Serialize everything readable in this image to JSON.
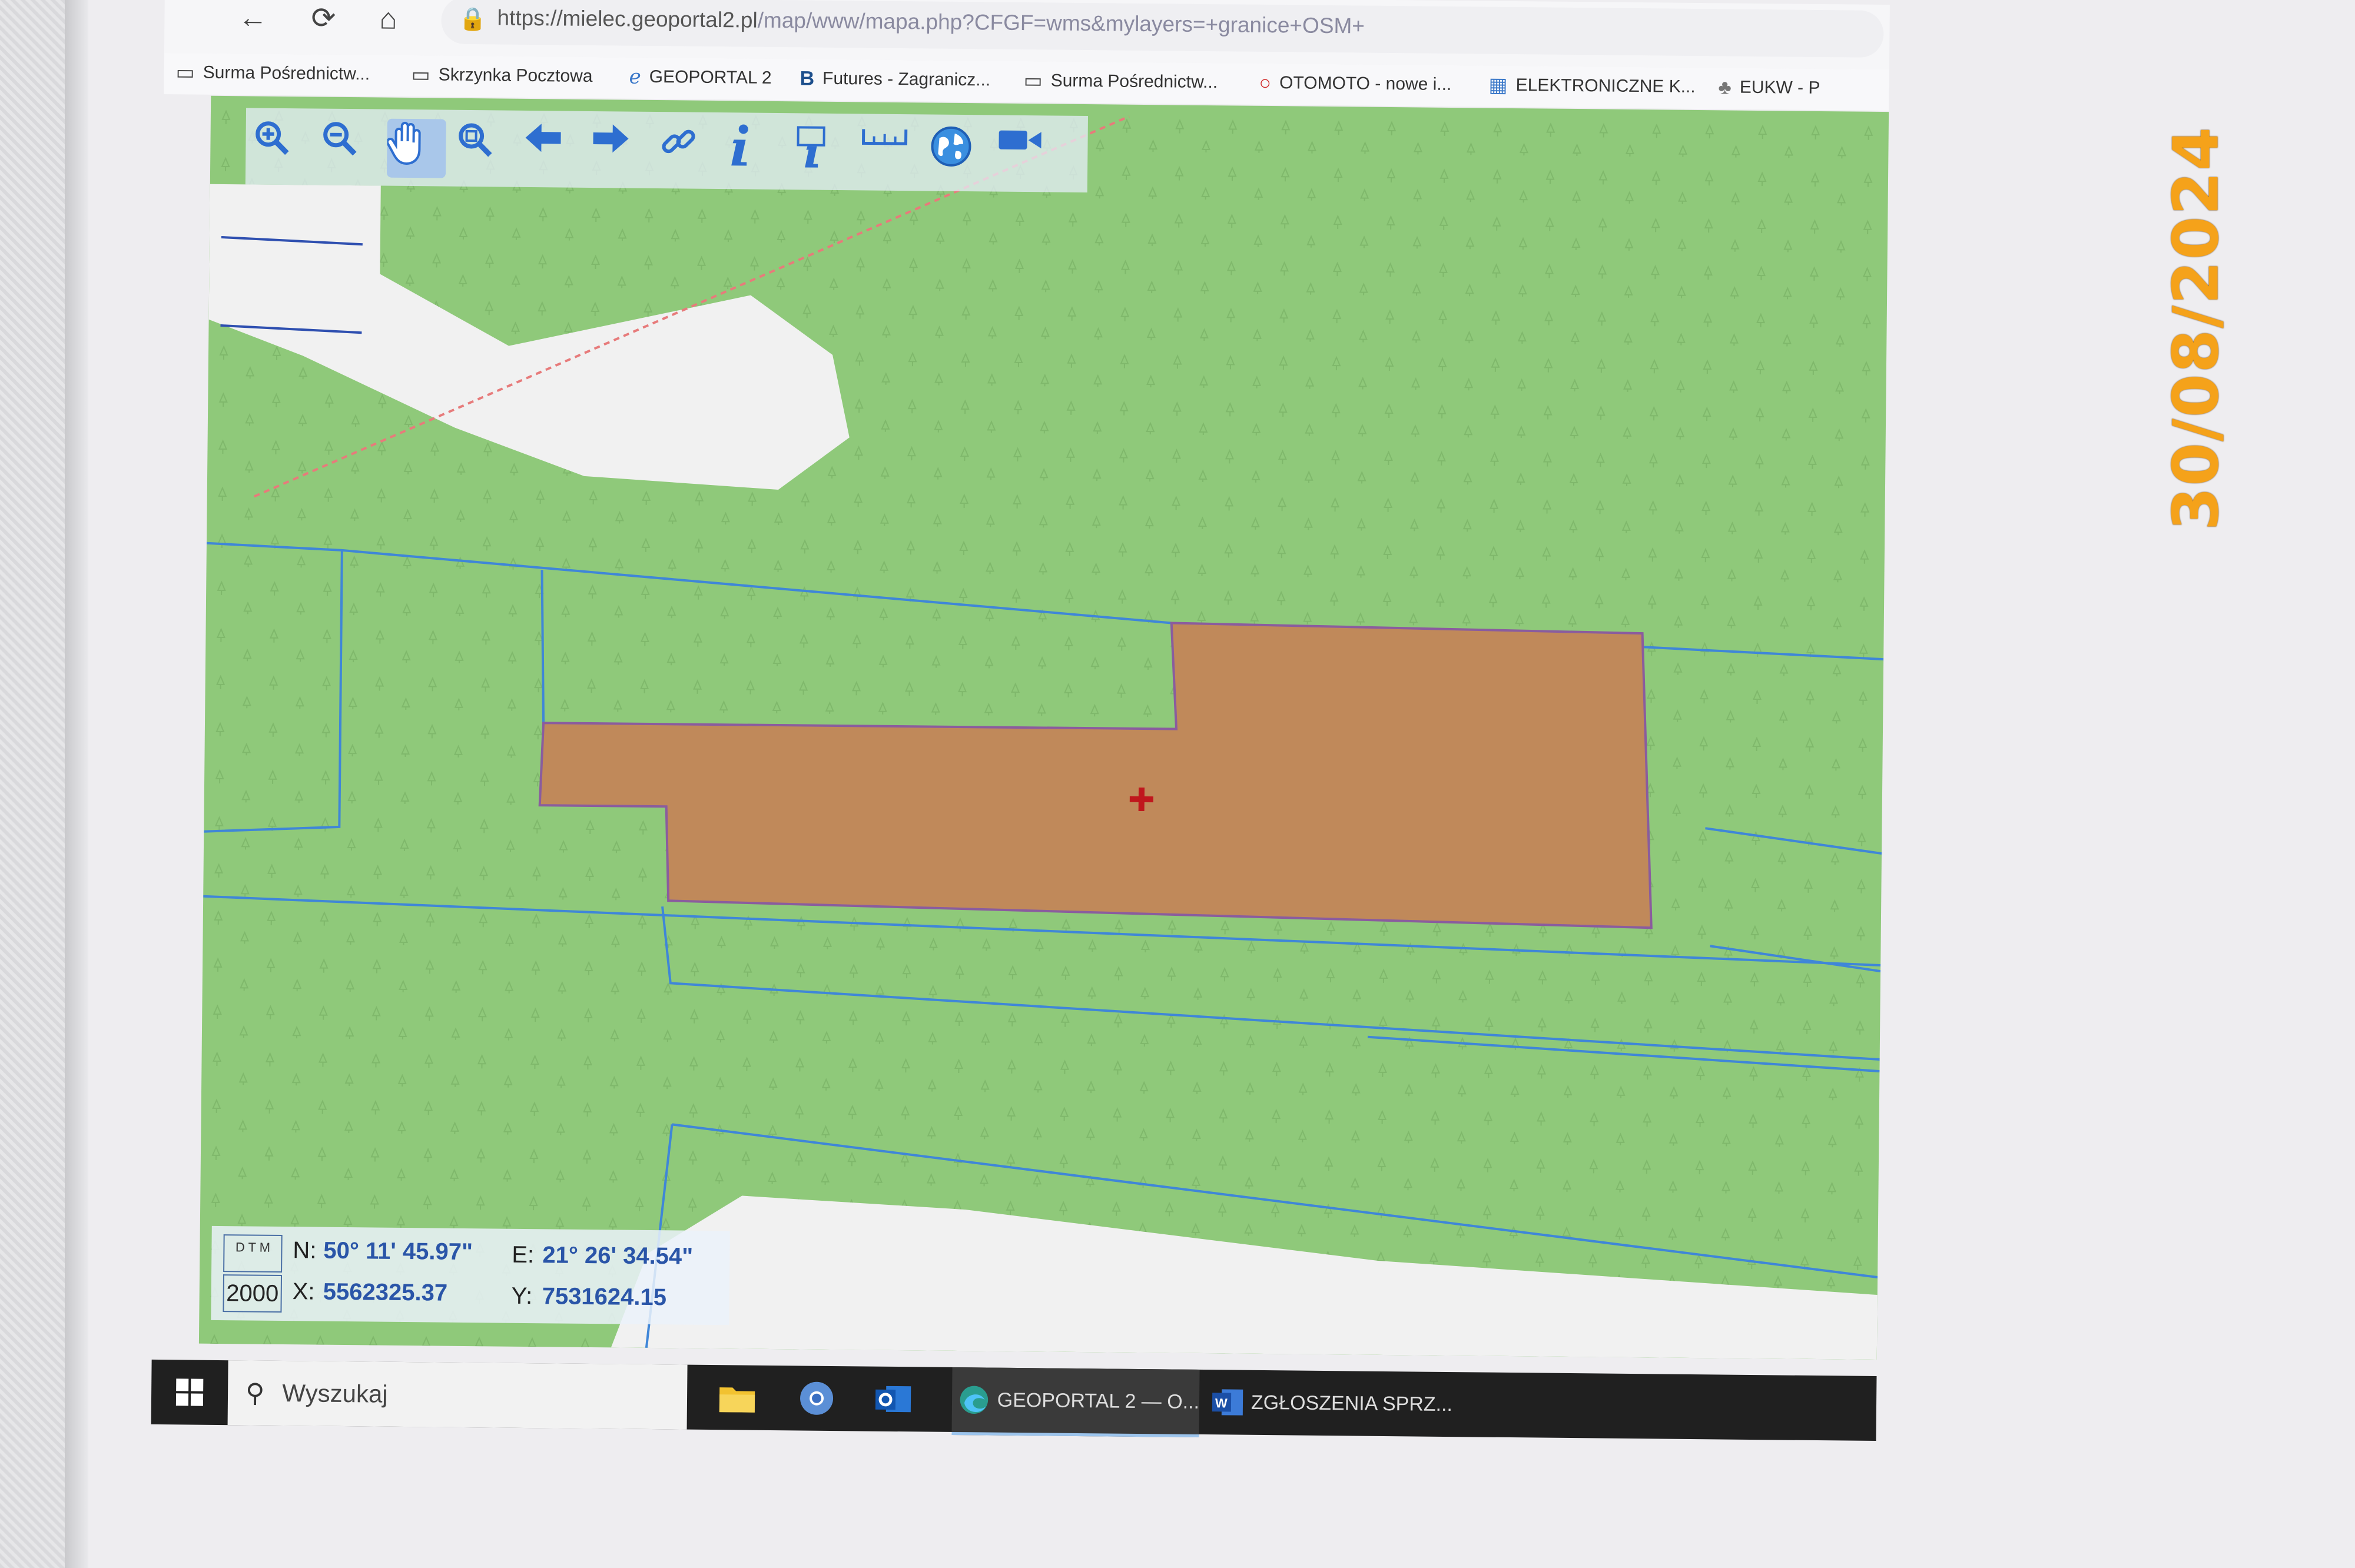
{
  "browser": {
    "url_host": "https://mielec.geoportal2.pl",
    "url_path": "/map/www/mapa.php?CFGF=wms&mylayers=+granice+OSM+"
  },
  "bookmarks": [
    {
      "icon": "page-icon",
      "label": "Surma Pośrednictw..."
    },
    {
      "icon": "page-icon",
      "label": "Skrzynka Pocztowa"
    },
    {
      "icon": "geoportal-icon",
      "label": "GEOPORTAL 2"
    },
    {
      "icon": "b-logo-icon",
      "label": "Futures - Zagranicz..."
    },
    {
      "icon": "page-icon",
      "label": "Surma Pośrednictw..."
    },
    {
      "icon": "otomoto-icon",
      "label": "OTOMOTO - nowe i..."
    },
    {
      "icon": "ek-logo-icon",
      "label": "ELEKTRONICZNE K..."
    },
    {
      "icon": "eagle-icon",
      "label": "EUKW - P"
    }
  ],
  "toolbar": {
    "tools": [
      "zoom-in",
      "zoom-out",
      "pan",
      "zoom-extent",
      "back",
      "forward",
      "link",
      "info",
      "info-edit",
      "measure",
      "globe",
      "camera"
    ],
    "active": "pan"
  },
  "coords": {
    "scale_icon": "D T M",
    "scale": "2000",
    "n_label": "N:",
    "n_value": "50° 11' 45.97\"",
    "e_label": "E:",
    "e_value": "21° 26' 34.54\"",
    "x_label": "X:",
    "x_value": "5562325.37",
    "y_label": "Y:",
    "y_value": "7531624.15"
  },
  "taskbar": {
    "search_placeholder": "Wyszukaj",
    "apps": [
      {
        "name": "GEOPORTAL 2 — O...",
        "active": true
      },
      {
        "name": "ZGŁOSZENIA SPRZ...",
        "active": false
      }
    ]
  },
  "stamp": {
    "date": "30/08/2024"
  },
  "colors": {
    "map_green": "#8fc97a",
    "parcel_brown": "#c0895a",
    "boundary_blue": "#3f86d8",
    "road_white": "#f1f1f1",
    "stamp_orange": "#f5a21a"
  }
}
